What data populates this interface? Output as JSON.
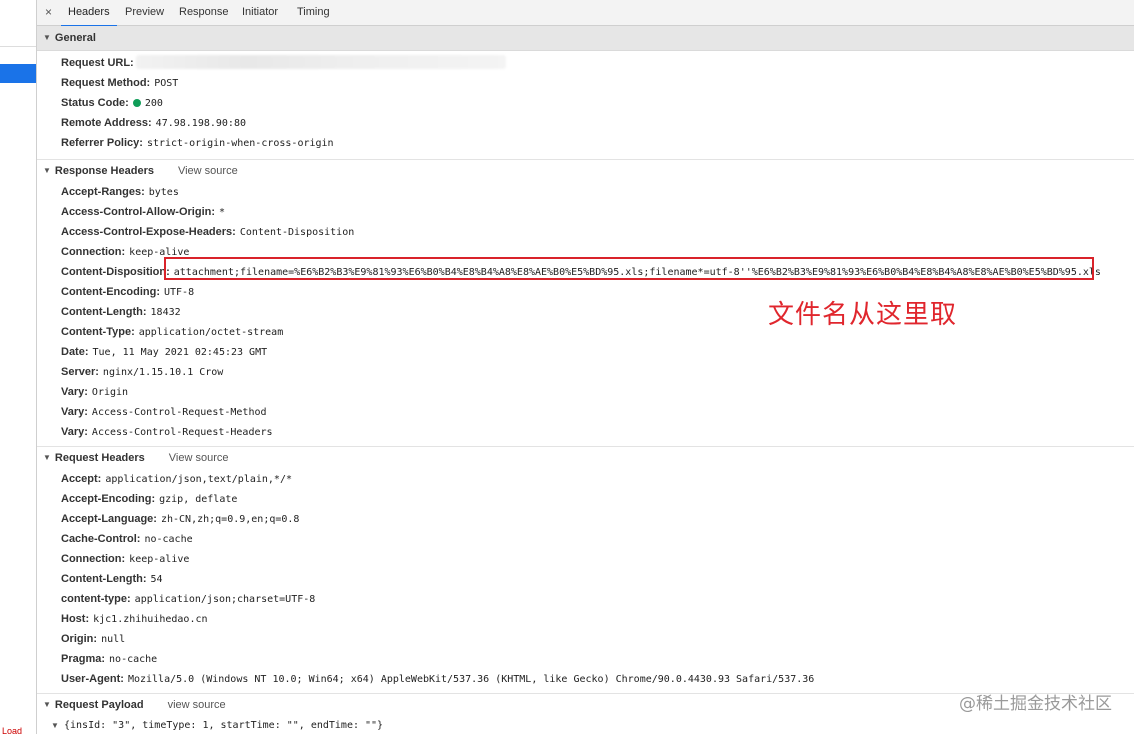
{
  "tabs": {
    "close": "×",
    "items": [
      "Headers",
      "Preview",
      "Response",
      "Initiator",
      "Timing"
    ]
  },
  "general": {
    "title": "General",
    "rows": [
      {
        "key": "Request URL:",
        "value": ""
      },
      {
        "key": "Request Method:",
        "value": "POST"
      },
      {
        "key": "Status Code:",
        "value": "200"
      },
      {
        "key": "Remote Address:",
        "value": "47.98.198.90:80"
      },
      {
        "key": "Referrer Policy:",
        "value": "strict-origin-when-cross-origin"
      }
    ]
  },
  "response_headers": {
    "title": "Response Headers",
    "view_source": "View source",
    "rows": [
      {
        "key": "Accept-Ranges:",
        "value": "bytes"
      },
      {
        "key": "Access-Control-Allow-Origin:",
        "value": "*"
      },
      {
        "key": "Access-Control-Expose-Headers:",
        "value": "Content-Disposition"
      },
      {
        "key": "Connection:",
        "value": "keep-alive"
      },
      {
        "key": "Content-Disposition:",
        "value": "attachment;filename=%E6%B2%B3%E9%81%93%E6%B0%B4%E8%B4%A8%E8%AE%B0%E5%BD%95.xls;filename*=utf-8''%E6%B2%B3%E9%81%93%E6%B0%B4%E8%B4%A8%E8%AE%B0%E5%BD%95.xls"
      },
      {
        "key": "Content-Encoding:",
        "value": "UTF-8"
      },
      {
        "key": "Content-Length:",
        "value": "18432"
      },
      {
        "key": "Content-Type:",
        "value": "application/octet-stream"
      },
      {
        "key": "Date:",
        "value": "Tue, 11 May 2021 02:45:23 GMT"
      },
      {
        "key": "Server:",
        "value": "nginx/1.15.10.1 Crow"
      },
      {
        "key": "Vary:",
        "value": "Origin"
      },
      {
        "key": "Vary:",
        "value": "Access-Control-Request-Method"
      },
      {
        "key": "Vary:",
        "value": "Access-Control-Request-Headers"
      }
    ]
  },
  "request_headers": {
    "title": "Request Headers",
    "view_source": "View source",
    "rows": [
      {
        "key": "Accept:",
        "value": "application/json,text/plain,*/*"
      },
      {
        "key": "Accept-Encoding:",
        "value": "gzip, deflate"
      },
      {
        "key": "Accept-Language:",
        "value": "zh-CN,zh;q=0.9,en;q=0.8"
      },
      {
        "key": "Cache-Control:",
        "value": "no-cache"
      },
      {
        "key": "Connection:",
        "value": "keep-alive"
      },
      {
        "key": "Content-Length:",
        "value": "54"
      },
      {
        "key": "content-type:",
        "value": "application/json;charset=UTF-8"
      },
      {
        "key": "Host:",
        "value": "kjc1.zhihuihedao.cn"
      },
      {
        "key": "Origin:",
        "value": "null"
      },
      {
        "key": "Pragma:",
        "value": "no-cache"
      },
      {
        "key": "User-Agent:",
        "value": "Mozilla/5.0 (Windows NT 10.0; Win64; x64) AppleWebKit/537.36 (KHTML, like Gecko) Chrome/90.0.4430.93 Safari/537.36"
      }
    ]
  },
  "payload": {
    "title": "Request Payload",
    "view_source": "view source",
    "body": "{insId: \"3\", timeType: 1, startTime: \"\", endTime: \"\"}"
  },
  "annotation": "文件名从这里取",
  "watermark": "@稀土掘金技术社区",
  "left_strip_text": "Load",
  "colors": {
    "accent": "#1a73e8",
    "highlight": "#d9232a",
    "status_ok": "#0f9d58"
  }
}
